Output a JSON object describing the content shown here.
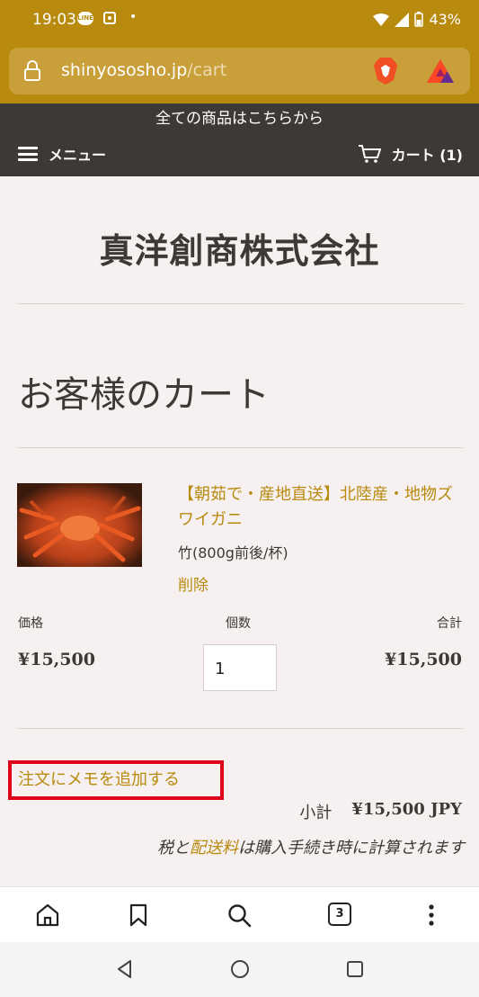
{
  "status": {
    "time": "19:03",
    "line_badge": "LINE",
    "dot": "•",
    "battery": "43%"
  },
  "browser": {
    "url_domain": "shinyososho.jp",
    "url_path": "/cart"
  },
  "header": {
    "banner": "全ての商品はこちらから",
    "menu_label": "メニュー",
    "cart_label": "カート (1)"
  },
  "shop": {
    "title": "真洋創商株式会社"
  },
  "cart": {
    "heading": "お客様のカート",
    "item": {
      "name": "【朝茹で・産地直送】北陸産・地物ズワイガニ",
      "variant": "竹(800g前後/杯)",
      "remove": "削除",
      "price_label": "価格",
      "qty_label": "個数",
      "total_label": "合計",
      "price": "¥15,500",
      "quantity": "1",
      "total": "¥15,500"
    },
    "memo_link": "注文にメモを追加する",
    "subtotal_label": "小計",
    "subtotal_value": "¥15,500 JPY",
    "tax_pre": "税と",
    "tax_link": "配送料",
    "tax_post": "は購入手続き時に計算されます"
  },
  "toolbar": {
    "tab_count": "3"
  },
  "colors": {
    "accent": "#b88a0e",
    "dark": "#3d3936",
    "highlight": "#e0001a"
  }
}
